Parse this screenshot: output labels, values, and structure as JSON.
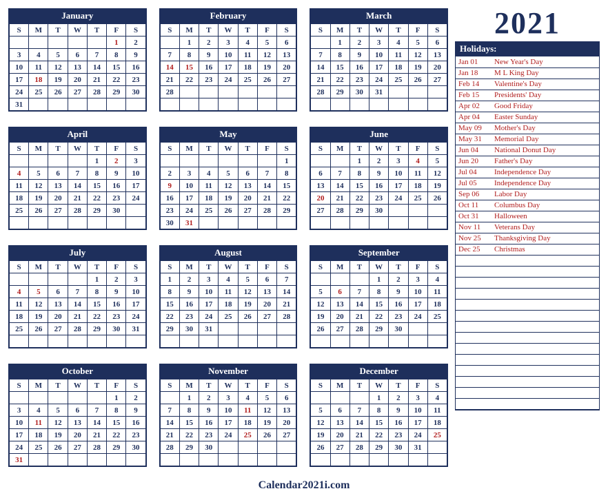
{
  "year": "2021",
  "footer": "Calendar2021i.com",
  "day_headers": [
    "S",
    "M",
    "T",
    "W",
    "T",
    "F",
    "S"
  ],
  "months": [
    {
      "name": "January",
      "start": 5,
      "days": 31,
      "holidays": [
        1,
        18
      ]
    },
    {
      "name": "February",
      "start": 1,
      "days": 28,
      "holidays": [
        14,
        15
      ]
    },
    {
      "name": "March",
      "start": 1,
      "days": 31,
      "holidays": []
    },
    {
      "name": "April",
      "start": 4,
      "days": 30,
      "holidays": [
        2,
        4
      ]
    },
    {
      "name": "May",
      "start": 6,
      "days": 31,
      "holidays": [
        9,
        31
      ]
    },
    {
      "name": "June",
      "start": 2,
      "days": 30,
      "holidays": [
        4,
        20
      ]
    },
    {
      "name": "July",
      "start": 4,
      "days": 31,
      "holidays": [
        4,
        5
      ]
    },
    {
      "name": "August",
      "start": 0,
      "days": 31,
      "holidays": []
    },
    {
      "name": "September",
      "start": 3,
      "days": 30,
      "holidays": [
        6
      ]
    },
    {
      "name": "October",
      "start": 5,
      "days": 31,
      "holidays": [
        11,
        31
      ]
    },
    {
      "name": "November",
      "start": 1,
      "days": 30,
      "holidays": [
        11,
        25
      ]
    },
    {
      "name": "December",
      "start": 3,
      "days": 31,
      "holidays": [
        25
      ]
    }
  ],
  "holidays_header": "Holidays:",
  "holidays": [
    {
      "date": "Jan 01",
      "name": "New Year's Day"
    },
    {
      "date": "Jan 18",
      "name": "M L King Day"
    },
    {
      "date": "Feb 14",
      "name": "Valentine's Day"
    },
    {
      "date": "Feb 15",
      "name": "Presidents' Day"
    },
    {
      "date": "Apr 02",
      "name": "Good Friday"
    },
    {
      "date": "Apr 04",
      "name": "Easter Sunday"
    },
    {
      "date": "May 09",
      "name": "Mother's Day"
    },
    {
      "date": "May 31",
      "name": "Memorial Day"
    },
    {
      "date": "Jun 04",
      "name": "National Donut Day"
    },
    {
      "date": "Jun 20",
      "name": "Father's Day"
    },
    {
      "date": "Jul 04",
      "name": "Independence Day"
    },
    {
      "date": "Jul 05",
      "name": "Independence Day"
    },
    {
      "date": "Sep 06",
      "name": "Labor Day"
    },
    {
      "date": "Oct 11",
      "name": "Columbus Day"
    },
    {
      "date": "Oct 31",
      "name": "Halloween"
    },
    {
      "date": "Nov 11",
      "name": "Veterans Day"
    },
    {
      "date": "Nov 25",
      "name": "Thanksgiving Day"
    },
    {
      "date": "Dec 25",
      "name": "Christmas"
    }
  ],
  "empty_holiday_rows": 14
}
